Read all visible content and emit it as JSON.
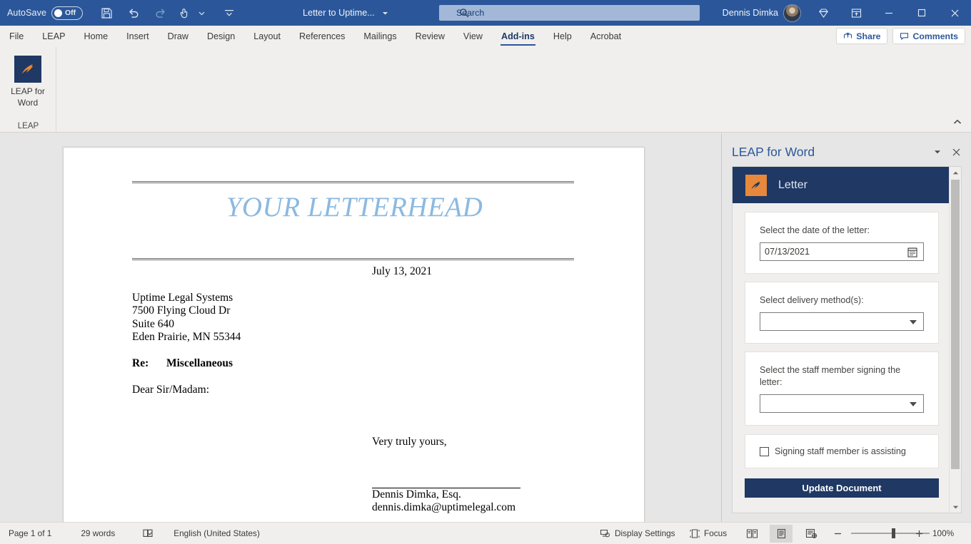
{
  "titlebar": {
    "autosave_label": "AutoSave",
    "autosave_state": "Off",
    "save_icon": "save-icon",
    "undo_icon": "undo-icon",
    "redo_icon": "redo-icon",
    "touch_icon": "touch-mode-icon",
    "customize_icon": "customize-quick-access-icon",
    "document_title": "Letter to Uptime...",
    "search_placeholder": "Search",
    "search_icon": "search-icon",
    "account_name": "Dennis Dimka",
    "diamond_icon": "diamond-icon",
    "ribbon_display_icon": "ribbon-display-options-icon",
    "minimize_icon": "minimize-icon",
    "maximize_icon": "maximize-icon",
    "close_icon": "close-icon",
    "accent": "#2b579a"
  },
  "tabs": [
    {
      "label": "File",
      "active": false
    },
    {
      "label": "LEAP",
      "active": false
    },
    {
      "label": "Home",
      "active": false
    },
    {
      "label": "Insert",
      "active": false
    },
    {
      "label": "Draw",
      "active": false
    },
    {
      "label": "Design",
      "active": false
    },
    {
      "label": "Layout",
      "active": false
    },
    {
      "label": "References",
      "active": false
    },
    {
      "label": "Mailings",
      "active": false
    },
    {
      "label": "Review",
      "active": false
    },
    {
      "label": "View",
      "active": false
    },
    {
      "label": "Add-ins",
      "active": true
    },
    {
      "label": "Help",
      "active": false
    },
    {
      "label": "Acrobat",
      "active": false
    }
  ],
  "tabstrip_right": {
    "share_label": "Share",
    "share_icon": "share-icon",
    "comments_label": "Comments",
    "comments_icon": "comment-icon"
  },
  "ribbon": {
    "leap_button_line1": "LEAP for",
    "leap_button_line2": "Word",
    "group_name": "LEAP",
    "collapse_icon": "collapse-ribbon-icon",
    "logo_bg": "#1f3864",
    "logo_fg": "#e8883a"
  },
  "document": {
    "letterhead": "YOUR LETTERHEAD",
    "date": "July 13, 2021",
    "address": [
      "Uptime Legal Systems",
      "7500 Flying Cloud Dr",
      "Suite 640",
      "Eden Prairie, MN 55344"
    ],
    "re_label": "Re:",
    "re_value": "Miscellaneous",
    "salutation": "Dear Sir/Madam:",
    "closing": "Very truly yours,",
    "signer_name": "Dennis Dimka, Esq.",
    "signer_email": "dennis.dimka@uptimelegal.com",
    "letterhead_color": "#8cb9e0"
  },
  "pane": {
    "title": "LEAP for Word",
    "menu_icon": "chevron-down-icon",
    "close_icon": "close-icon",
    "addin_title": "Letter",
    "addin_logo_icon": "leap-logo-icon",
    "date_label": "Select the date of the letter:",
    "date_value": "07/13/2021",
    "calendar_icon": "calendar-icon",
    "delivery_label": "Select delivery method(s):",
    "delivery_value": "",
    "staff_label": "Select the staff member signing the letter:",
    "staff_value": "",
    "checkbox_label": "Signing staff member is assisting",
    "checkbox_checked": false,
    "update_button": "Update Document",
    "header_bg": "#1f3864",
    "scroll_up_icon": "scroll-up-icon",
    "scroll_down_icon": "scroll-down-icon"
  },
  "statusbar": {
    "page": "Page 1 of 1",
    "words": "29 words",
    "proofing_icon": "proofing-errors-icon",
    "language": "English (United States)",
    "display_settings": "Display Settings",
    "display_settings_icon": "display-settings-icon",
    "focus": "Focus",
    "focus_icon": "focus-icon",
    "read_mode_icon": "read-mode-icon",
    "print_layout_icon": "print-layout-icon",
    "web_layout_icon": "web-layout-icon",
    "zoom_out_icon": "zoom-out-icon",
    "zoom_in_icon": "zoom-in-icon",
    "zoom_level": "100%"
  }
}
